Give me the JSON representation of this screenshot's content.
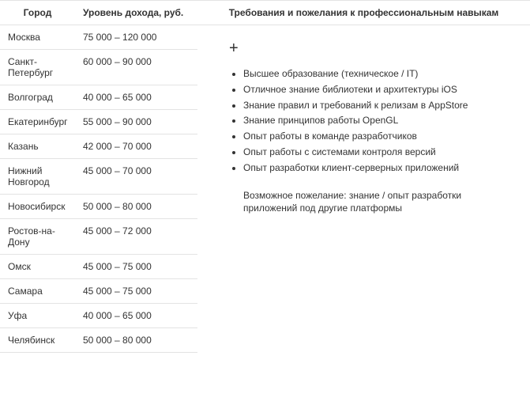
{
  "headers": {
    "city": "Город",
    "salary": "Уровень дохода, руб.",
    "requirements": "Требования и пожелания к профессиональным навыкам"
  },
  "rows": [
    {
      "city": "Москва",
      "salary": "75 000 – 120 000"
    },
    {
      "city": "Санкт-Петербург",
      "salary": "60 000 – 90 000"
    },
    {
      "city": "Волгоград",
      "salary": "40 000 – 65 000"
    },
    {
      "city": "Екатеринбург",
      "salary": "55 000 – 90 000"
    },
    {
      "city": "Казань",
      "salary": "42 000 – 70 000"
    },
    {
      "city": "Нижний Новгород",
      "salary": "45 000 – 70 000"
    },
    {
      "city": "Новосибирск",
      "salary": "50 000 – 80 000"
    },
    {
      "city": "Ростов-на-Дону",
      "salary": "45 000 – 72 000"
    },
    {
      "city": "Омск",
      "salary": "45 000 – 75 000"
    },
    {
      "city": "Самара",
      "salary": "45 000 – 75 000"
    },
    {
      "city": "Уфа",
      "salary": "40 000 – 65 000"
    },
    {
      "city": "Челябинск",
      "salary": "50 000 – 80 000"
    }
  ],
  "plus_symbol": "+",
  "requirements_list": [
    "Высшее образование (техническое / IT)",
    "Отличное знание библиотеки и архитектуры iOS",
    "Знание правил и требований к релизам в AppStore",
    "Знание принципов работы OpenGL",
    "Опыт работы в команде разработчиков",
    "Опыт работы с системами контроля версий",
    "Опыт разработки клиент-серверных приложений"
  ],
  "optional_note": "Возможное пожелание: знание / опыт разработки приложений под другие платформы"
}
